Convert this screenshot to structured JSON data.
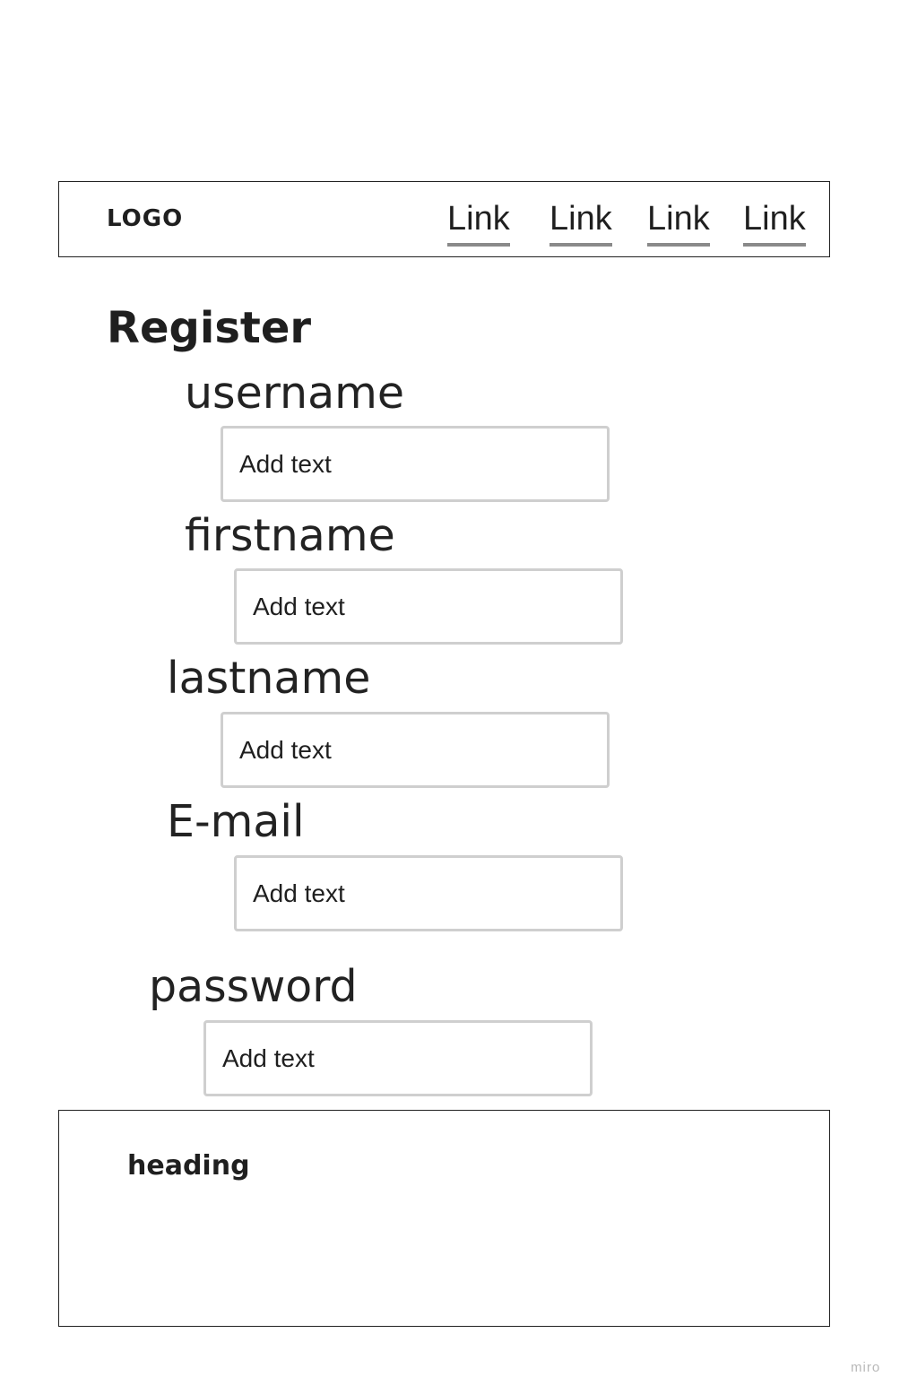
{
  "header": {
    "logo": "LOGO",
    "links": [
      "Link",
      "Link",
      "Link",
      "Link"
    ]
  },
  "form": {
    "title": "Register",
    "fields": [
      {
        "label": "username",
        "placeholder": "Add text"
      },
      {
        "label": "firstname",
        "placeholder": "Add text"
      },
      {
        "label": "lastname",
        "placeholder": "Add text"
      },
      {
        "label": "E-mail",
        "placeholder": "Add text"
      },
      {
        "label": "password",
        "placeholder": "Add text"
      }
    ]
  },
  "footer": {
    "heading": "heading"
  },
  "watermark": "miro"
}
